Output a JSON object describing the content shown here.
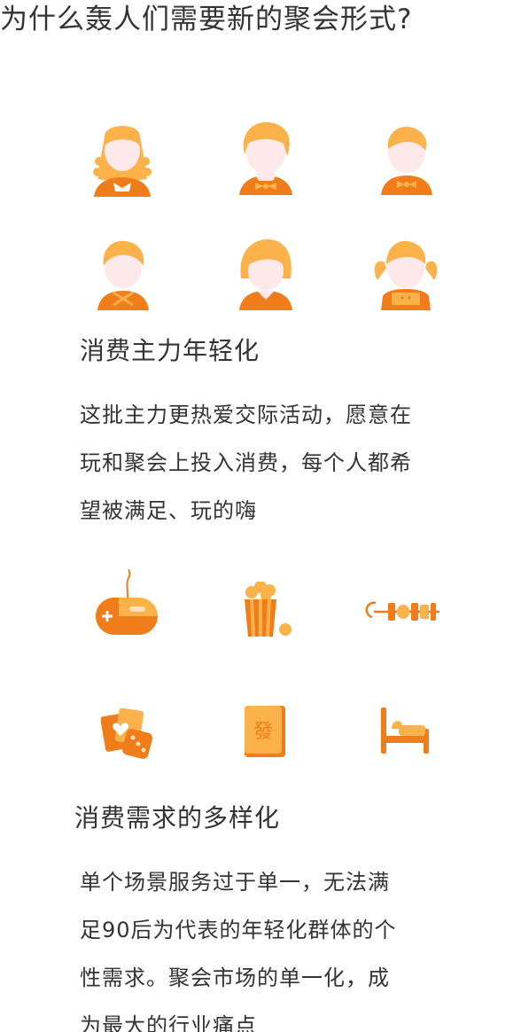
{
  "page_title": "为什么轰人们需要新的聚会形式?",
  "colors": {
    "accent_orange": "#f07c1a",
    "light_orange": "#fbb24a",
    "skin": "#fde8ea",
    "text": "#333333"
  },
  "section_consumers": {
    "heading": "消费主力年轻化",
    "body_lines": [
      "这批主力更热爱交际活动，愿意在",
      "玩和聚会上投入消费，每个人都希",
      "望被满足、玩的嗨"
    ],
    "icons": [
      "woman-long-hair-avatar-icon",
      "man-bowtie-avatar-icon",
      "boy-bowtie-avatar-icon",
      "boy-ribbon-avatar-icon",
      "girl-bob-hair-avatar-icon",
      "girl-pigtails-avatar-icon"
    ]
  },
  "section_demand": {
    "heading": "消费需求的多样化",
    "body_lines": [
      "单个场景服务过于单一，无法满",
      "足90后为代表的年轻化群体的个",
      "性需求。聚会市场的单一化，成",
      "为最大的行业痛点"
    ],
    "icons": [
      "game-mouse-icon",
      "popcorn-icon",
      "kebab-skewer-icon",
      "cards-and-dice-icon",
      "mahjong-tile-icon",
      "bed-icon"
    ],
    "mahjong_tile_char": "發"
  }
}
